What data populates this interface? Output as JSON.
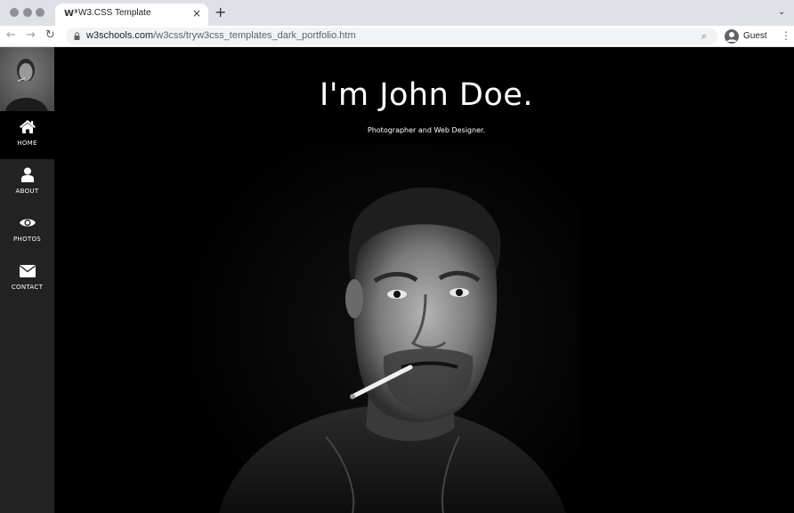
{
  "browser": {
    "tab_title": "W3.CSS Template",
    "tab_favicon": "W³",
    "tab_close": "×",
    "new_tab": "+",
    "tabs_dropdown": "⌄",
    "back": "←",
    "forward": "→",
    "reload": "↻",
    "url_domain": "w3schools.com",
    "url_path": "/w3css/tryw3css_templates_dark_portfolio.htm",
    "profile_name": "Guest",
    "menu": "⋮",
    "zoom_icon": "⌕"
  },
  "sidebar": {
    "items": [
      {
        "label": "HOME",
        "icon": "home-icon",
        "active": true
      },
      {
        "label": "ABOUT",
        "icon": "user-icon",
        "active": false
      },
      {
        "label": "PHOTOS",
        "icon": "eye-icon",
        "active": false
      },
      {
        "label": "CONTACT",
        "icon": "envelope-icon",
        "active": false
      }
    ]
  },
  "hero": {
    "title": "I'm John Doe.",
    "subtitle": "Photographer and Web Designer."
  },
  "colors": {
    "page_background": "#000000",
    "sidebar_background": "#222222",
    "sidebar_active": "#000000",
    "text": "#ffffff"
  }
}
